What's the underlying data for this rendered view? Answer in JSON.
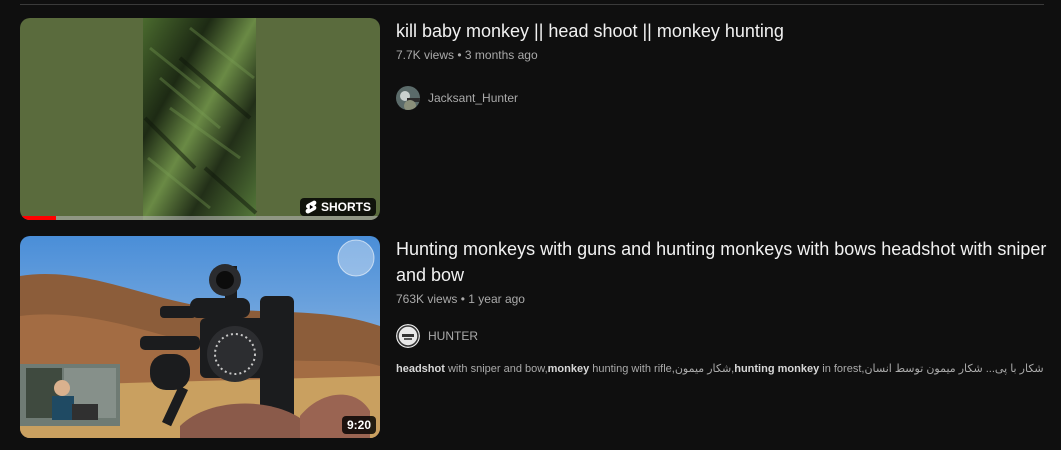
{
  "results": [
    {
      "title": "kill baby monkey || head shoot || monkey hunting",
      "views": "7.7K views",
      "age": "3 months ago",
      "channel": "Jacksant_Hunter",
      "badge": "SHORTS",
      "watched_fraction": 0.1
    },
    {
      "title": "Hunting monkeys with guns and hunting monkeys with bows headshot with sniper and bow",
      "views": "763K views",
      "age": "1 year ago",
      "channel": "HUNTER",
      "duration": "9:20",
      "description": {
        "d1": "headshot",
        "d2": " with sniper and bow,",
        "d3": "monkey",
        "d4": " hunting with rifle,شکار میمون,",
        "d5": "hunting",
        "d6": " ",
        "d7": "monkey",
        "d8": " in forest,شکار با پی",
        "d9": "... شکار میمون توسط انسان"
      }
    }
  ],
  "meta_separator": "•",
  "colors": {
    "progress": "#ff0000",
    "background": "#0f0f0f",
    "meta_text": "#aaaaaa"
  }
}
